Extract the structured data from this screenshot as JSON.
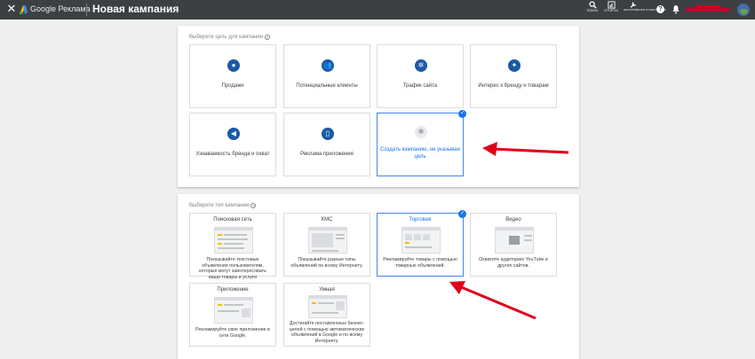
{
  "header": {
    "close_icon": "close-icon",
    "brand": "Google Реклама",
    "title": "Новая кампания",
    "actions": [
      {
        "label": "ПОИСК",
        "icon": "search-icon"
      },
      {
        "label": "ОТЧЕТЫ",
        "icon": "reports-icon"
      },
      {
        "label": "ИНСТРУМЕНТЫ И НАСТРОЙКИ",
        "icon": "wrench-icon"
      }
    ],
    "help": "?",
    "notification_badge": "1"
  },
  "goal_section": {
    "label": "Выберите цель для кампании",
    "cards": [
      {
        "label": "Продажи",
        "icon": "tag-icon"
      },
      {
        "label": "Потенциальные клиенты",
        "icon": "people-icon"
      },
      {
        "label": "Трафик сайта",
        "icon": "cursor-icon"
      },
      {
        "label": "Интерес к бренду и товарам",
        "icon": "sparkle-icon"
      },
      {
        "label": "Узнаваемость бренда и охват",
        "icon": "megaphone-icon"
      },
      {
        "label": "Реклама приложения",
        "icon": "phone-icon"
      },
      {
        "label": "Создать кампанию, не указывая цель",
        "icon": "gear-icon",
        "selected": true
      }
    ]
  },
  "type_section": {
    "label": "Выберите тип кампании",
    "cards": [
      {
        "title": "Поисковая сеть",
        "desc": "Показывайте текстовые объявления пользователям, которые могут заинтересовать ваши товары и услуги"
      },
      {
        "title": "КМС",
        "desc": "Показывайте разные типы объявлений по всему Интернету."
      },
      {
        "title": "Торговая",
        "desc": "Рекламируйте товары с помощью товарных объявлений.",
        "selected": true
      },
      {
        "title": "Видео",
        "desc": "Охватите аудиторию YouTube и других сайтов."
      },
      {
        "title": "Приложение",
        "desc": "Рекламируйте свое приложение в сети Google."
      },
      {
        "title": "Умная",
        "desc": "Достигайте поставленных бизнес-целей с помощью автоматических объявлений в Google и по всему Интернету."
      }
    ]
  },
  "colors": {
    "topbar": "#3c4043",
    "accent": "#1a73e8",
    "icon_fill": "#1a5aa6",
    "arrow": "#e0001b"
  }
}
